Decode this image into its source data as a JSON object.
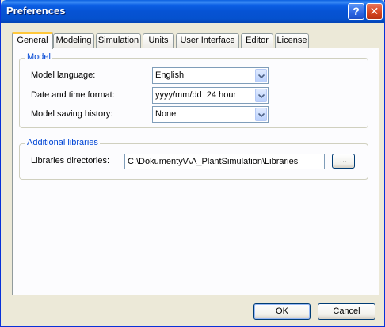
{
  "window": {
    "title": "Preferences",
    "help_glyph": "?",
    "close_glyph": "✕"
  },
  "tabs": [
    {
      "label": "General",
      "active": true
    },
    {
      "label": "Modeling"
    },
    {
      "label": "Simulation"
    },
    {
      "label": "Units"
    },
    {
      "label": "User Interface"
    },
    {
      "label": "Editor"
    },
    {
      "label": "License"
    }
  ],
  "model_group": {
    "title": "Model",
    "language_label": "Model language:",
    "language_value": "English",
    "datetime_label": "Date and time format:",
    "datetime_value": "yyyy/mm/dd  24 hour",
    "history_label": "Model saving history:",
    "history_value": "None"
  },
  "libraries_group": {
    "title": "Additional libraries",
    "dir_label": "Libraries directories:",
    "dir_value": "C:\\Dokumenty\\AA_PlantSimulation\\Libraries",
    "browse_label": "..."
  },
  "footer": {
    "ok_label": "OK",
    "cancel_label": "Cancel"
  }
}
